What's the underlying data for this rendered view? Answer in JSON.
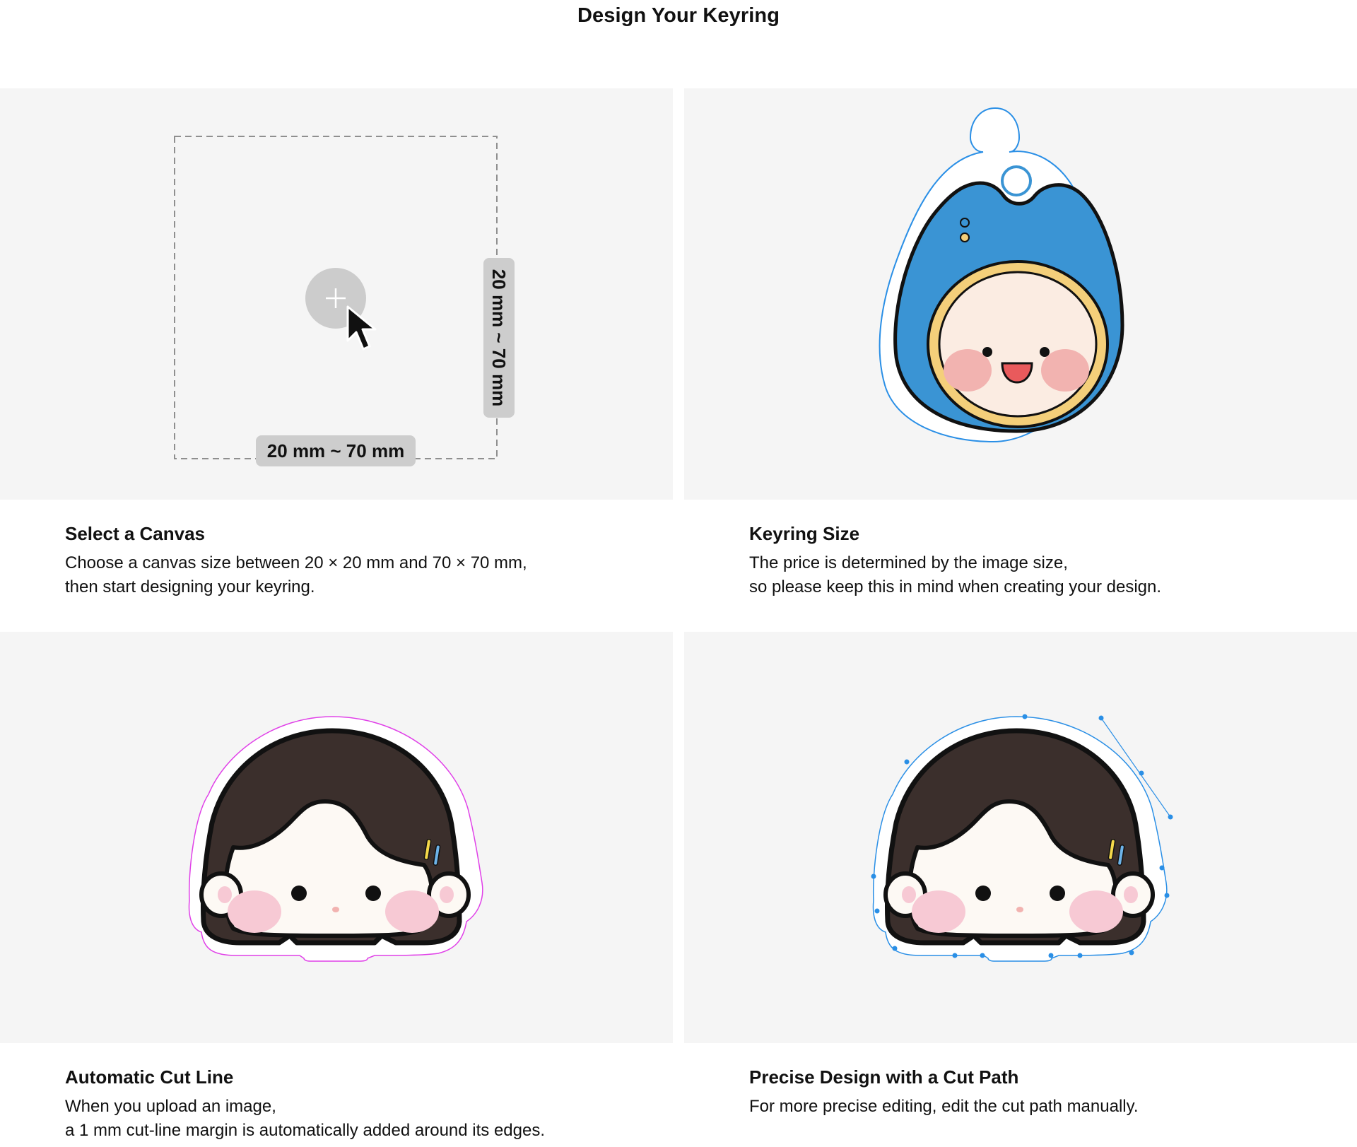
{
  "page": {
    "title": "Design Your Keyring"
  },
  "sections": [
    {
      "id": "select-canvas",
      "title": "Select a Canvas",
      "body_lines": [
        "Choose a canvas size between 20 × 20 mm and 70 × 70 mm,",
        "then start designing your keyring."
      ],
      "illustration": {
        "width_label": "20 mm ~ 70 mm",
        "height_label": "20 mm ~ 70 mm",
        "icons": [
          "add-icon",
          "cursor-icon"
        ]
      }
    },
    {
      "id": "keyring-size",
      "title": "Keyring Size",
      "body_lines": [
        "The price is determined by the image size,",
        "so please keep this in mind when creating your design."
      ]
    },
    {
      "id": "automatic-cut-line",
      "title": "Automatic Cut Line",
      "body_lines": [
        "When you upload an image,",
        "a 1 mm cut-line margin is automatically added around its edges."
      ]
    },
    {
      "id": "precise-cut-path",
      "title": "Precise Design with a Cut Path",
      "body_lines": [
        "For more precise editing, edit the cut path manually."
      ]
    }
  ],
  "colors": {
    "panel_background": "#f5f5f5",
    "cut_line_auto": "#e040e8",
    "cut_path_manual": "#2a8fe6",
    "character_blue": "#3a94d4",
    "hair_brown": "#3b2f2c",
    "cheek_pink": "#f7c9d4",
    "face_cream": "#fdf9f4"
  }
}
